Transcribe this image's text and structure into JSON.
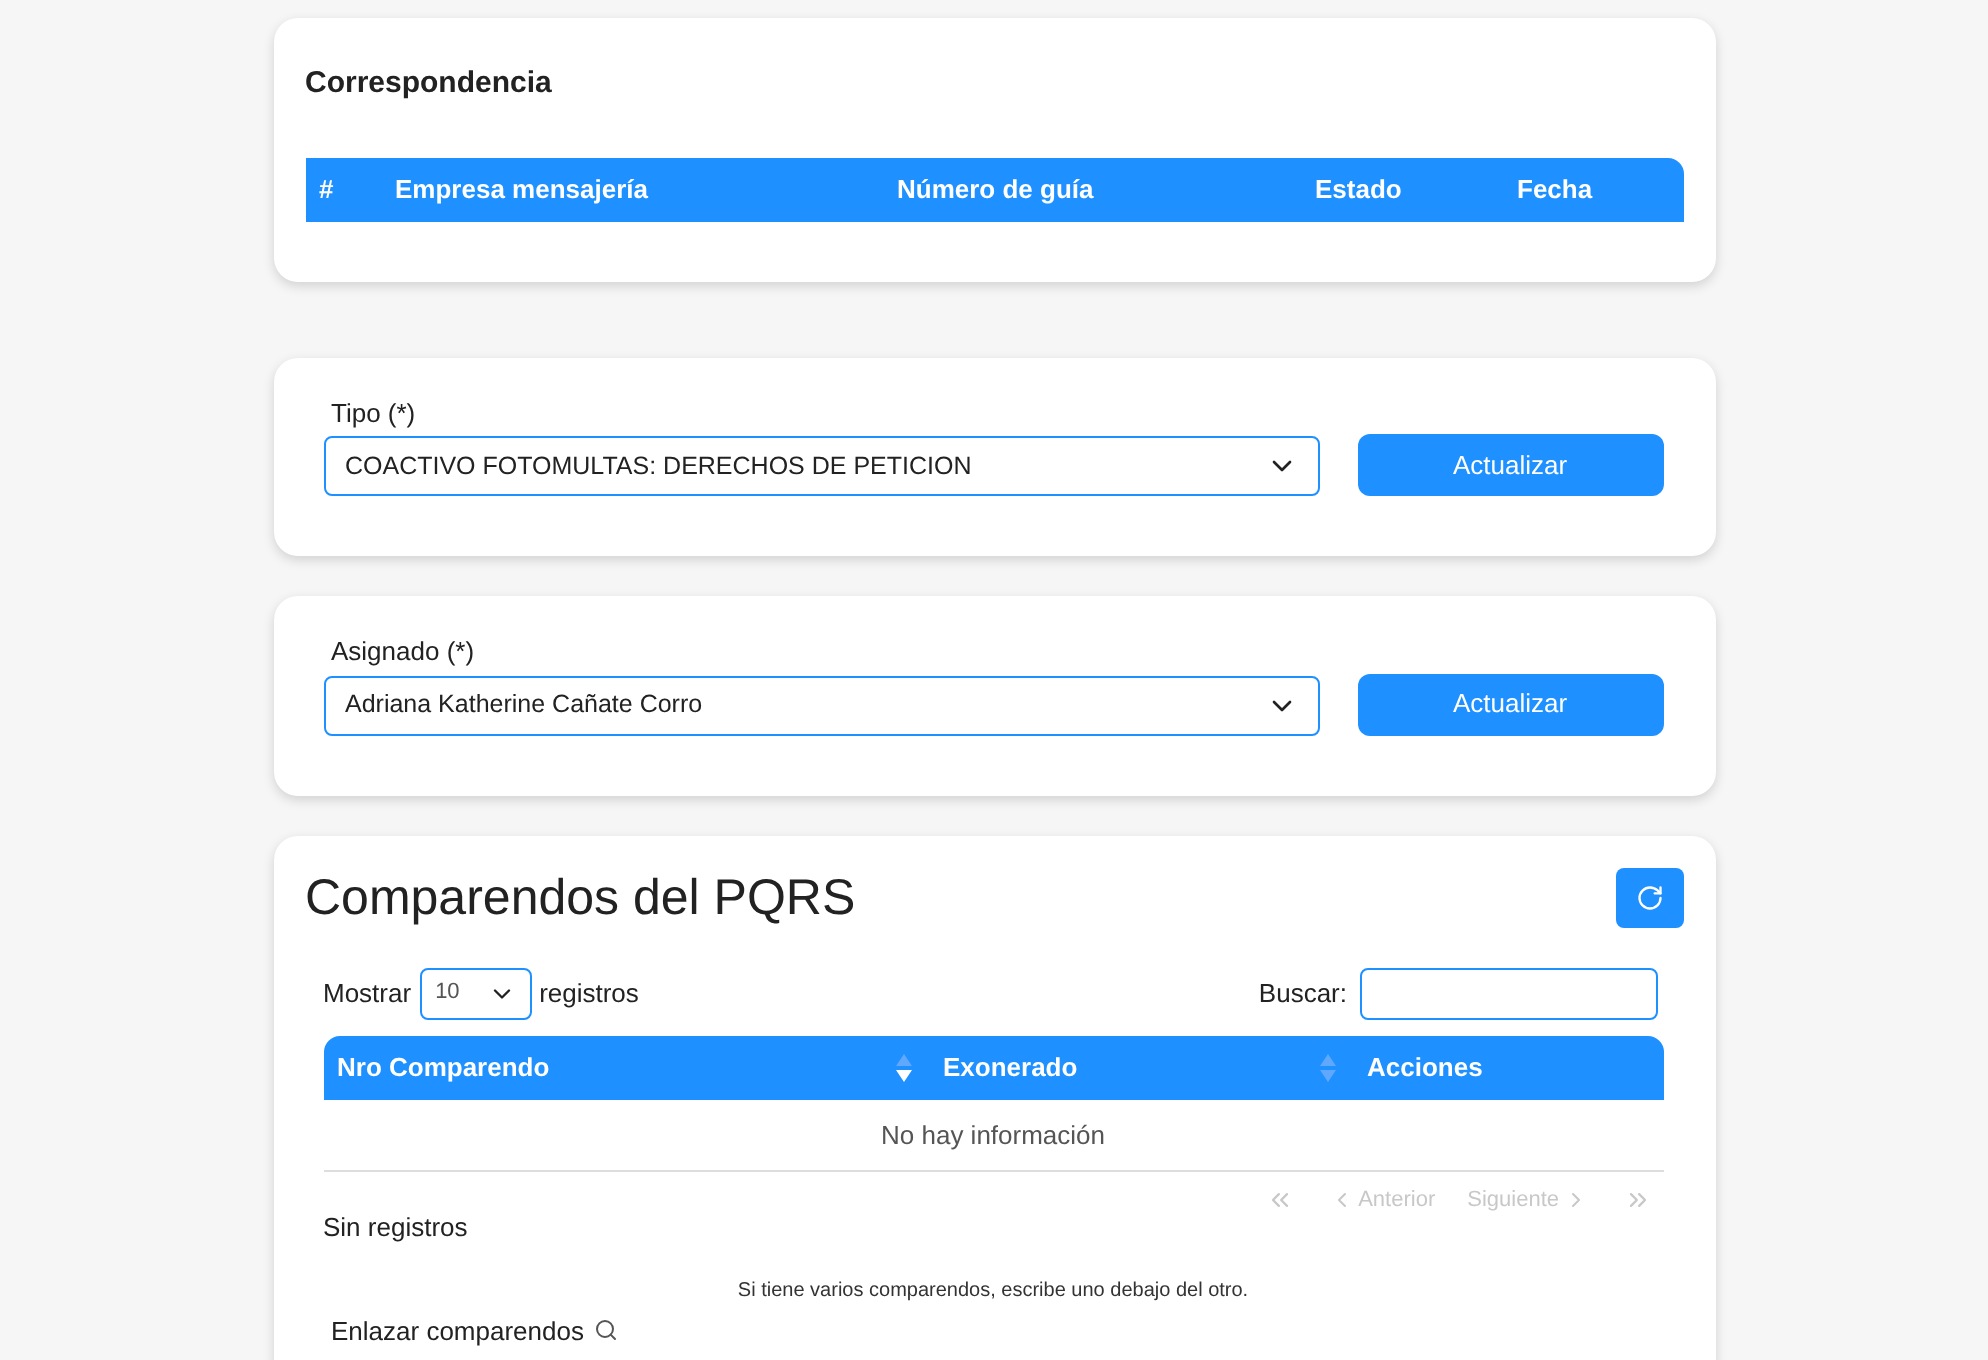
{
  "correspondencia": {
    "title": "Correspondencia",
    "columns": [
      "#",
      "Empresa mensajería",
      "Número de guía",
      "Estado",
      "Fecha"
    ]
  },
  "selectors": [
    {
      "label": "Tipo (*)",
      "value": "COACTIVO FOTOMULTAS: DERECHOS DE PETICION",
      "button": "Actualizar"
    },
    {
      "label": "Asignado (*)",
      "value": "Adriana Katherine Cañate Corro",
      "button": "Actualizar"
    }
  ],
  "comparendos": {
    "title": "Comparendos del PQRS",
    "show_label": "Mostrar",
    "page_size": "10",
    "records_label": "registros",
    "search_label": "Buscar:",
    "columns": [
      {
        "label": "Nro Comparendo",
        "sortable": true,
        "sorted_desc": true
      },
      {
        "label": "Exonerado",
        "sortable": true,
        "sorted_desc": false
      },
      {
        "label": "Acciones",
        "sortable": false
      }
    ],
    "empty": "No hay información",
    "info": "Sin registros",
    "pagination": [
      {
        "kind": "first",
        "disabled": true
      },
      {
        "label": "Anterior",
        "kind": "prev",
        "disabled": true
      },
      {
        "label": "Siguiente",
        "kind": "next",
        "disabled": true
      },
      {
        "kind": "last",
        "disabled": true
      }
    ],
    "hint": "Si tiene varios comparendos, escribe uno debajo del otro.",
    "link_label": "Enlazar comparendos"
  }
}
